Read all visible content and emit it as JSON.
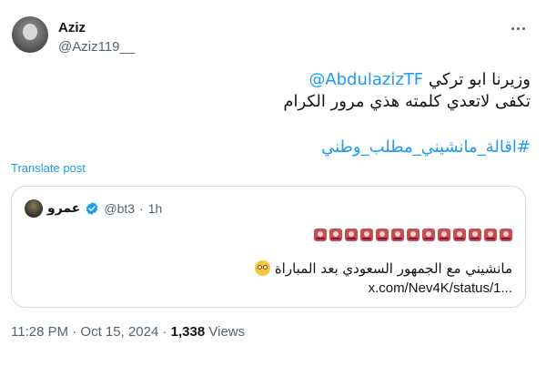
{
  "author": {
    "display_name": "Aziz",
    "handle": "@Aziz119__"
  },
  "tweet": {
    "line1_text": "وزيرنا ابو تركي",
    "line1_mention": "@AbdulazizTF",
    "line2": "تكفى لاتعدي كلمته هذي مرور الكرام",
    "hashtag": "#اقالة_مانشيني_مطلب_وطني",
    "translate_label": "Translate post"
  },
  "quote": {
    "name": "عمرو",
    "handle": "@bt3",
    "dot": "·",
    "time": "1h",
    "alarm_count": 13,
    "text": "مانشيني مع الجمهور السعودي بعد المباراة",
    "link": "x.com/Nev4K/status/1..."
  },
  "meta": {
    "time": "11:28 PM · Oct 15, 2024",
    "dot": "·",
    "views_count": "1,338",
    "views_label": "Views"
  },
  "colors": {
    "link": "#1d9bf0",
    "secondary_text": "#536471",
    "border": "#cfd9de",
    "verified": "#1d9bf0"
  },
  "icons": [
    "more-icon",
    "verified-icon",
    "police-light-icon",
    "flushed-face-icon"
  ]
}
